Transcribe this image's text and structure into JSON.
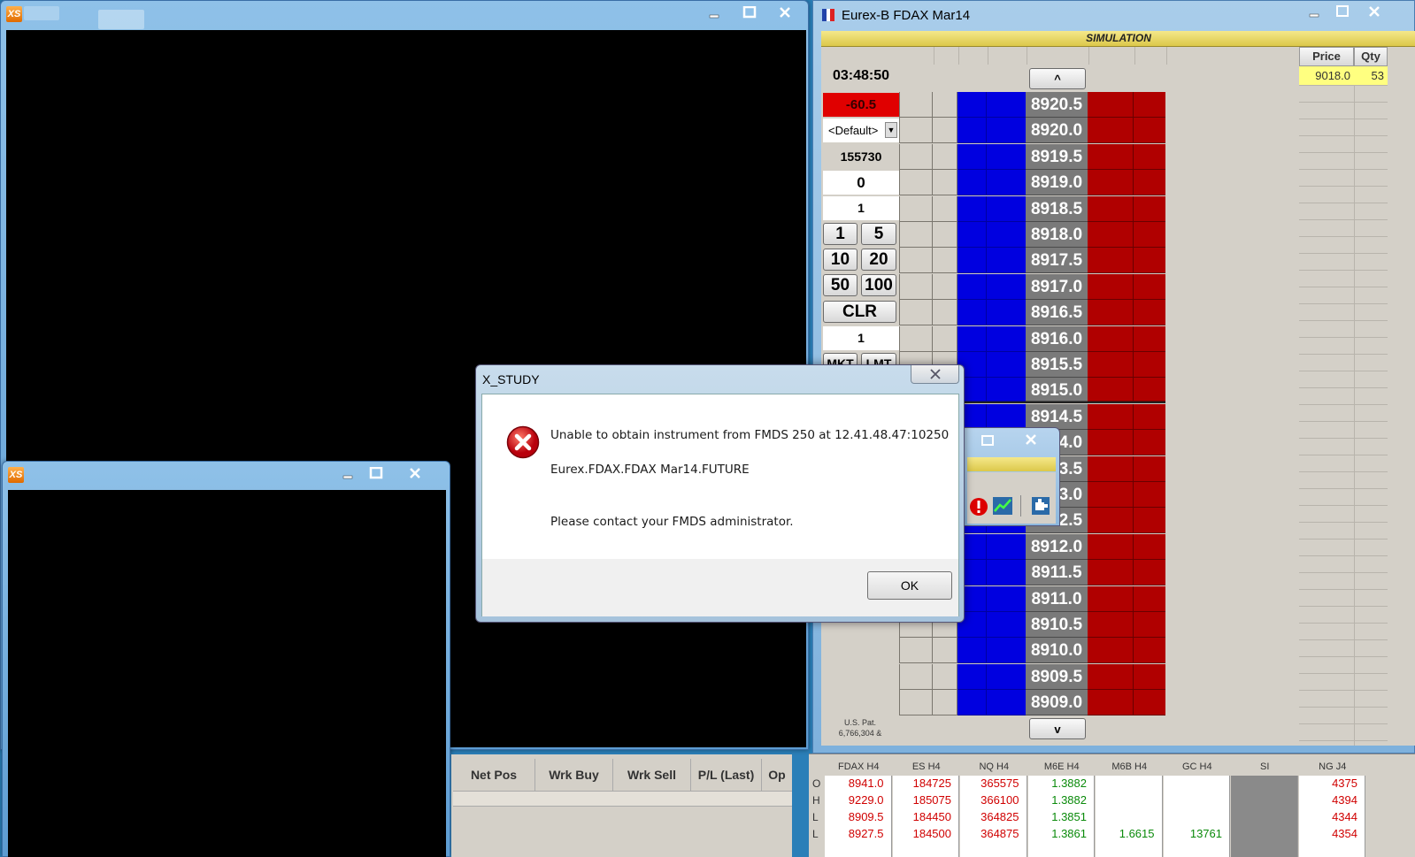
{
  "dom": {
    "title": "Eurex-B FDAX Mar14",
    "simulation": "SIMULATION",
    "time": "03:48:50",
    "pnl": "-60.5",
    "account": "<Default>",
    "volume": "155730",
    "position": "0",
    "qty": "1",
    "qty_buttons": [
      "1",
      "5",
      "10",
      "20",
      "50",
      "100"
    ],
    "clr": "CLR",
    "order_qty": "1",
    "mkt": "MKT",
    "lmt": "LMT",
    "scroll_up": "^",
    "scroll_down": "v",
    "patent": "U.S. Pat.\n6,766,304 &",
    "prices": [
      "8920.5",
      "8920.0",
      "8919.5",
      "8919.0",
      "8918.5",
      "8918.0",
      "8917.5",
      "8917.0",
      "8916.5",
      "8916.0",
      "8915.5",
      "8915.0",
      "8914.5",
      "8914.0",
      "8913.5",
      "8913.0",
      "8912.5",
      "8912.0",
      "8911.5",
      "8911.0",
      "8910.5",
      "8910.0",
      "8909.5",
      "8909.0"
    ],
    "pq": {
      "price_header": "Price",
      "qty_header": "Qty",
      "price": "9018.0",
      "qty": "53"
    }
  },
  "dialog": {
    "title": "X_STUDY",
    "line1": "Unable to obtain instrument from FMDS 250 at 12.41.48.47:10250",
    "line2": "Eurex.FDAX.FDAX Mar14.FUTURE",
    "line3": "Please contact your FMDS administrator.",
    "ok": "OK"
  },
  "positions": {
    "headers": [
      "Net Pos",
      "Wrk Buy",
      "Wrk Sell",
      "P/L (Last)",
      "Op"
    ]
  },
  "market": {
    "row_labels": [
      "O",
      "H",
      "L",
      "L"
    ],
    "columns": [
      {
        "name": "FDAX H4",
        "values": [
          "8941.0",
          "9229.0",
          "8909.5",
          "8927.5"
        ]
      },
      {
        "name": "ES H4",
        "values": [
          "184725",
          "185075",
          "184450",
          "184500"
        ]
      },
      {
        "name": "NQ H4",
        "values": [
          "365575",
          "366100",
          "364825",
          "364875"
        ]
      },
      {
        "name": "M6E H4",
        "values": [
          "1.3882",
          "1.3882",
          "1.3851",
          "1.3861"
        ]
      },
      {
        "name": "M6B H4",
        "values": [
          "",
          "",
          "",
          "1.6615"
        ]
      },
      {
        "name": "GC H4",
        "values": [
          "",
          "",
          "",
          "13761"
        ]
      },
      {
        "name": "SI",
        "values": [
          "",
          "",
          "",
          ""
        ]
      },
      {
        "name": "NG J4",
        "values": [
          "4375",
          "4394",
          "4344",
          "4354"
        ]
      }
    ]
  },
  "colors": {
    "bid": "#0000e0",
    "ask": "#b00000",
    "sim": "#dcc84a",
    "pnl_bg": "#e00000"
  },
  "icons": [
    "xs-logo-icon",
    "minimize-icon",
    "maximize-icon",
    "close-icon",
    "error-icon",
    "chart-icon",
    "plugin-icon"
  ]
}
